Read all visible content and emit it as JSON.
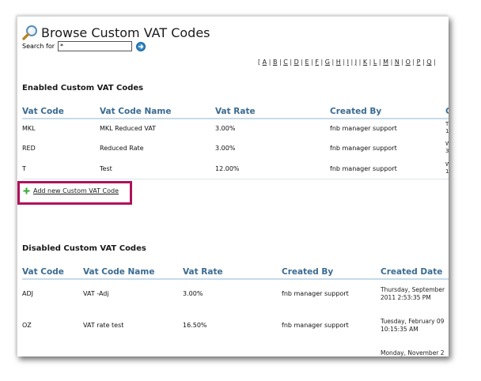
{
  "page": {
    "title": "Browse Custom VAT Codes"
  },
  "search": {
    "label": "Search for",
    "value": "*"
  },
  "alphabet": [
    "[",
    "A",
    "B",
    "C",
    "D",
    "E",
    "F",
    "G",
    "H",
    "I",
    "J",
    "K",
    "L",
    "M",
    "N",
    "O",
    "P",
    "Q"
  ],
  "enabled": {
    "heading": "Enabled Custom VAT Codes",
    "columns": [
      "Vat Code",
      "Vat Code Name",
      "Vat Rate",
      "Created By",
      "C"
    ],
    "rows": [
      {
        "code": "MKL",
        "name": "MKL Reduced VAT",
        "rate": "3.00%",
        "created_by": "fnb manager support",
        "clip_a": "T",
        "clip_b": "1"
      },
      {
        "code": "RED",
        "name": "Reduced Rate",
        "rate": "3.00%",
        "created_by": "fnb manager support",
        "clip_a": "W",
        "clip_b": "3"
      },
      {
        "code": "T",
        "name": "Test",
        "rate": "12.00%",
        "created_by": "fnb manager support",
        "clip_a": "W",
        "clip_b": "1"
      }
    ]
  },
  "add_link": {
    "label": "Add new Custom VAT Code"
  },
  "disabled": {
    "heading": "Disabled Custom VAT Codes",
    "columns": [
      "Vat Code",
      "Vat Code Name",
      "Vat Rate",
      "Created By",
      "Created Date"
    ],
    "rows": [
      {
        "code": "ADJ",
        "name": "VAT -Adj",
        "rate": "3.00%",
        "created_by": "fnb manager support",
        "date_line1": "Thursday, September",
        "date_line2": "2011 2:53:35 PM"
      },
      {
        "code": "OZ",
        "name": "VAT rate test",
        "rate": "16.50%",
        "created_by": "fnb manager support",
        "date_line1": "Tuesday, February 09",
        "date_line2": "10:15:35 AM"
      }
    ],
    "partial_row": "Monday, November 2"
  },
  "colors": {
    "header_text": "#3a6b92",
    "highlight_box": "#b0115a",
    "add_icon": "#3aa935",
    "go_button": "#2f86c9"
  }
}
